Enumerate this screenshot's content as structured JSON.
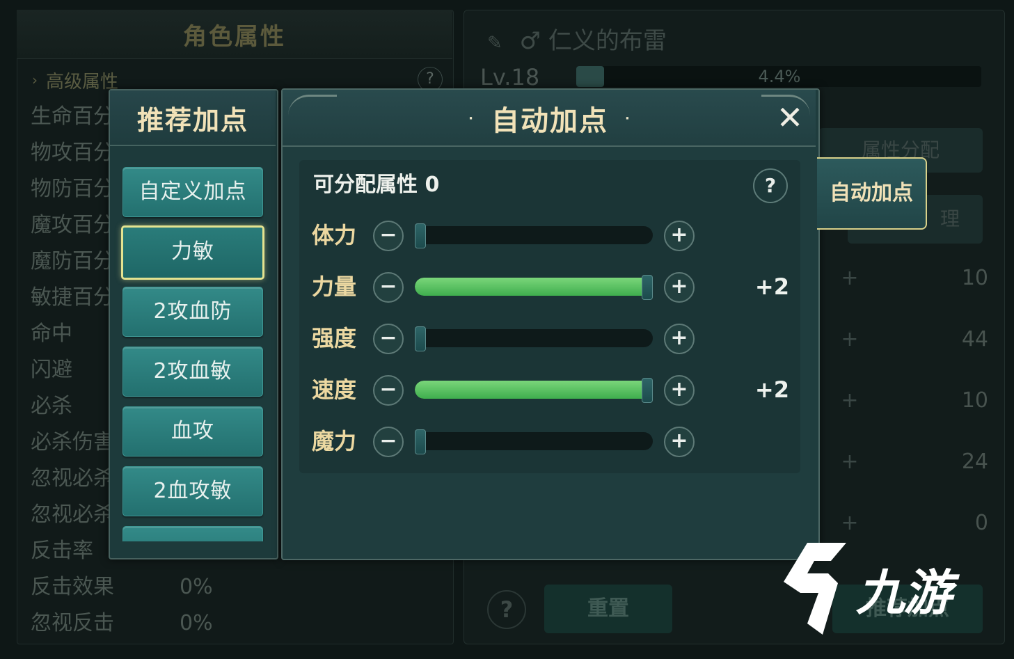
{
  "background": {
    "left_panel": {
      "title": "角色属性",
      "section": "高级属性",
      "section_help": "?",
      "stats": [
        {
          "label": "生命百分",
          "value": ""
        },
        {
          "label": "物攻百分",
          "value": ""
        },
        {
          "label": "物防百分",
          "value": ""
        },
        {
          "label": "魔攻百分",
          "value": ""
        },
        {
          "label": "魔防百分",
          "value": ""
        },
        {
          "label": "敏捷百分",
          "value": ""
        },
        {
          "label": "命中",
          "value": ""
        },
        {
          "label": "闪避",
          "value": ""
        },
        {
          "label": "必杀",
          "value": ""
        },
        {
          "label": "必杀伤害",
          "value": ""
        },
        {
          "label": "忽视必杀",
          "value": ""
        },
        {
          "label": "忽视必杀",
          "value": ""
        },
        {
          "label": "反击率",
          "value": ""
        },
        {
          "label": "反击效果",
          "value": "0%"
        },
        {
          "label": "忽视反击",
          "value": "0%"
        }
      ]
    },
    "right_panel": {
      "character_name": "仁义的布雷",
      "gender_icon": "♂",
      "level": "Lv.18",
      "exp_percent_text": "4.4%",
      "exp_fraction": 0.044,
      "attr_tab": "属性分配",
      "attr_button": "理",
      "plus": "+",
      "values": [
        "10",
        "44",
        "10",
        "24",
        "0"
      ],
      "help": "?",
      "reset_label": "重置",
      "recommend_label": "推荐加点"
    }
  },
  "recommend": {
    "title": "推荐加点",
    "items": [
      {
        "label": "自定义加点",
        "selected": false
      },
      {
        "label": "力敏",
        "selected": true
      },
      {
        "label": "2攻血防",
        "selected": false
      },
      {
        "label": "2攻血敏",
        "selected": false
      },
      {
        "label": "血攻",
        "selected": false
      },
      {
        "label": "2血攻敏",
        "selected": false
      },
      {
        "label": "",
        "selected": false
      }
    ]
  },
  "auto": {
    "title": "自动加点",
    "title_dot": "·",
    "close": "✕",
    "available_label": "可分配属性",
    "available_value": "0",
    "help": "?",
    "minus": "−",
    "plus": "+",
    "stats": [
      {
        "label": "体力",
        "fill_fraction": 0.0,
        "bonus": ""
      },
      {
        "label": "力量",
        "fill_fraction": 1.0,
        "bonus": "+2"
      },
      {
        "label": "强度",
        "fill_fraction": 0.0,
        "bonus": ""
      },
      {
        "label": "速度",
        "fill_fraction": 1.0,
        "bonus": "+2"
      },
      {
        "label": "魔力",
        "fill_fraction": 0.0,
        "bonus": ""
      }
    ],
    "side_tab": "自动加点"
  },
  "watermark": "九游",
  "colors": {
    "accent_gold": "#f1e2b8",
    "selected_border": "#e4e390",
    "fill_green": "#4fbd5a",
    "button_teal": "#2b7d7b"
  }
}
